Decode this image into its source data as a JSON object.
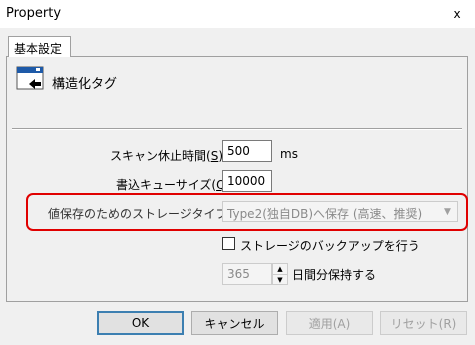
{
  "window": {
    "title": "Property",
    "close_glyph": "x"
  },
  "tab": {
    "label": "基本設定"
  },
  "object": {
    "icon": "structured-tag-icon",
    "label": "構造化タグ"
  },
  "fields": {
    "scan_pause": {
      "label": "スキャン休止時間(",
      "accel": "S",
      "label_end": ")：",
      "value": "500",
      "unit": "ms"
    },
    "write_queue": {
      "label": "書込キューサイズ(",
      "accel": "Q",
      "label_end": ")：",
      "value": "10000"
    },
    "value_storage": {
      "label": "値保存のためのストレージタイプ(",
      "accel": "T",
      "label_end": ")：",
      "selected": "Type2(独自DB)へ保存 (高速、推奨)"
    }
  },
  "backup": {
    "checkbox_label": "ストレージのバックアップを行う",
    "checked": false,
    "days_value": "365",
    "days_label": "日間分保持する"
  },
  "buttons": {
    "ok": "OK",
    "cancel": "キャンセル",
    "apply": "適用(A)",
    "reset": "リセット(R)"
  },
  "colors": {
    "highlight": "#e00000",
    "default_button_border": "#3c7fb1"
  }
}
